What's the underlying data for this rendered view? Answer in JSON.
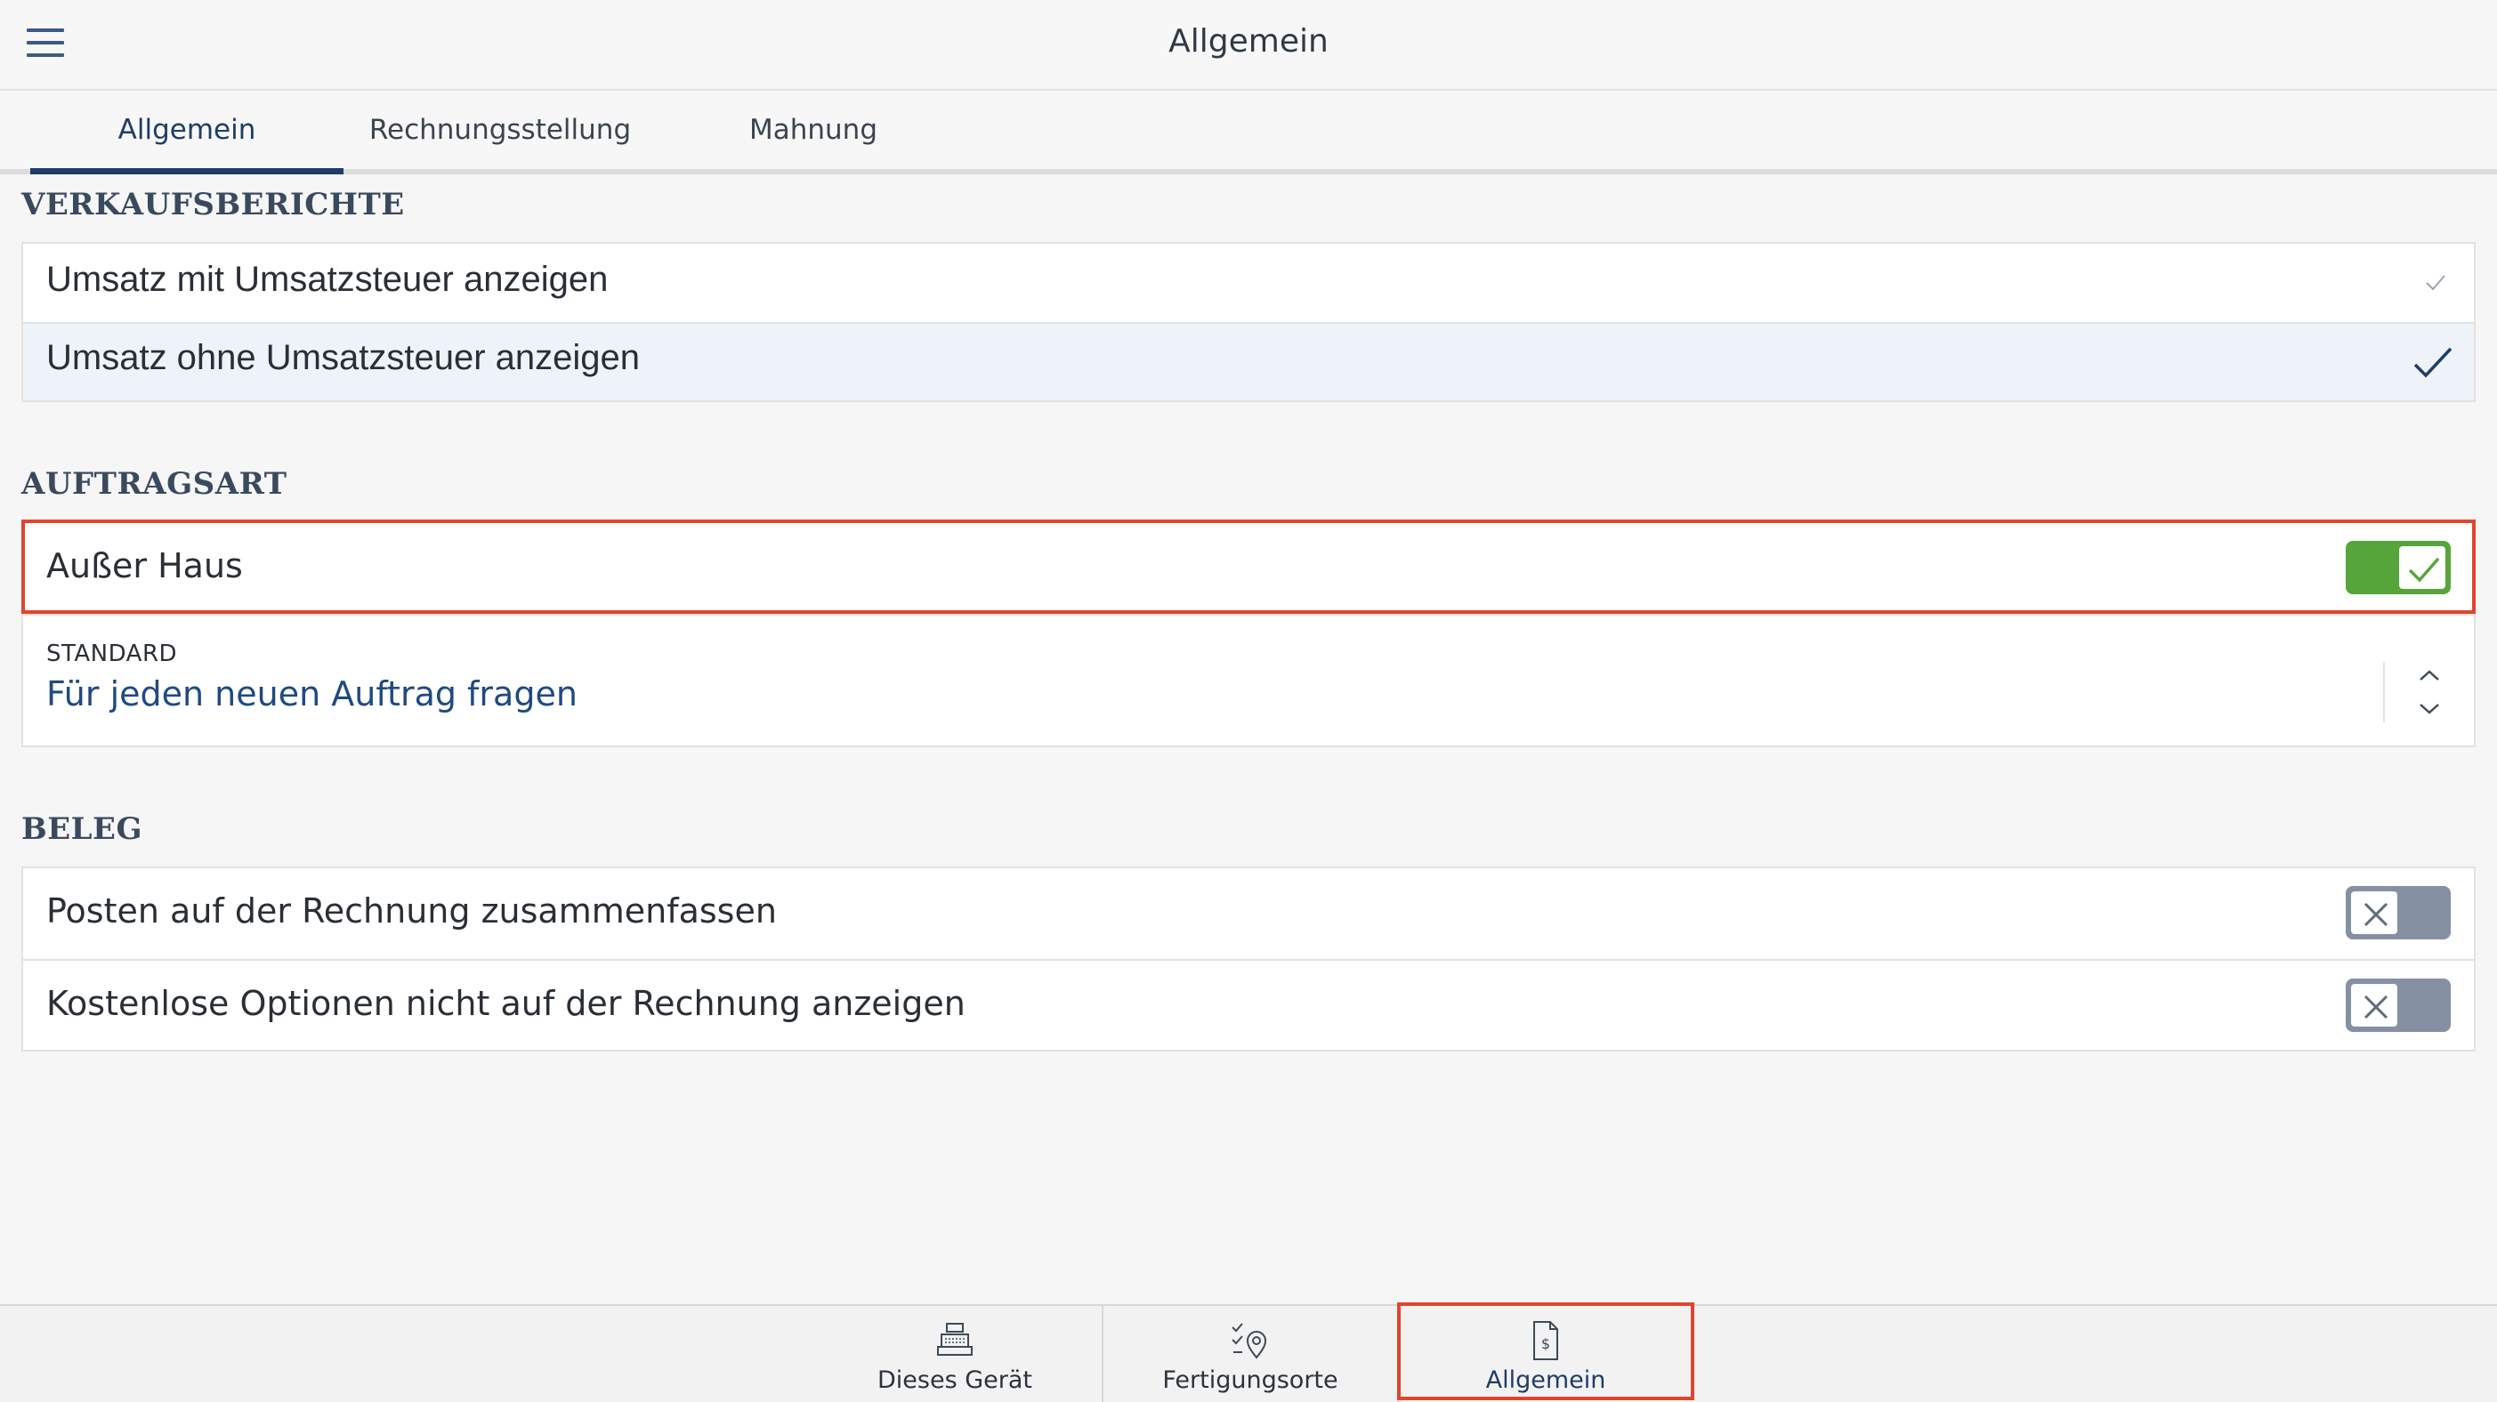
{
  "header": {
    "title": "Allgemein",
    "menu_icon": "hamburger-menu-icon"
  },
  "tabs": [
    {
      "label": "Allgemein",
      "active": true
    },
    {
      "label": "Rechnungsstellung",
      "active": false
    },
    {
      "label": "Mahnung",
      "active": false
    }
  ],
  "verkaufsberichte": {
    "title": "VERKAUFSBERICHTE",
    "options": [
      {
        "label": "Umsatz mit Umsatzsteuer anzeigen",
        "selected": false
      },
      {
        "label": "Umsatz ohne Umsatzsteuer anzeigen",
        "selected": true
      }
    ]
  },
  "auftragsart": {
    "title": "AUFTRAGSART",
    "ausser_haus": {
      "label": "Außer Haus",
      "enabled": true
    },
    "standard": {
      "label": "STANDARD",
      "value": "Für jeden neuen Auftrag fragen"
    }
  },
  "beleg": {
    "title": "BELEG",
    "items": [
      {
        "label": "Posten auf der Rechnung zusammenfassen",
        "enabled": false
      },
      {
        "label": "Kostenlose Optionen nicht auf der Rechnung anzeigen",
        "enabled": false
      }
    ]
  },
  "bottom_nav": [
    {
      "label": "Dieses Gerät",
      "icon": "cash-register-icon",
      "active": false
    },
    {
      "label": "Fertigungsorte",
      "icon": "location-checklist-icon",
      "active": false
    },
    {
      "label": "Allgemein",
      "icon": "invoice-dollar-icon",
      "active": true
    }
  ],
  "colors": {
    "accent": "#1f3d66",
    "toggle_on": "#56a53a",
    "toggle_off": "#8590a3",
    "highlight": "#e0452f"
  }
}
